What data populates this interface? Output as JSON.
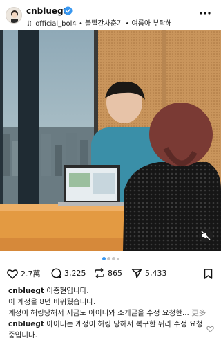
{
  "header": {
    "username": "cnbluegt",
    "music": "official_bol4 • 볼빨간사춘기 • 여름아 부탁해"
  },
  "actions": {
    "likes": "2.7萬",
    "comments": "3,225",
    "reposts": "865",
    "shares": "5,433"
  },
  "caption": {
    "username": "cnbluegt",
    "line1": "이종현입니다.",
    "line2": "이 계정을 8년 비워뒀습니다.",
    "line3": "계정이 해킹당해서 지금도 아이디와 소개글을 수정 요청한...",
    "more_label": "更多"
  },
  "comment": {
    "username": "cnbluegt",
    "text": "아이디는 계정이 해킹 당해서 복구한 뒤라 수정 요청중입니다."
  },
  "carousel": {
    "count": 4,
    "active_index": 0
  },
  "colors": {
    "verified": "#3897f0",
    "link": "#8e8e8e",
    "active_dot": "#3897f0"
  }
}
